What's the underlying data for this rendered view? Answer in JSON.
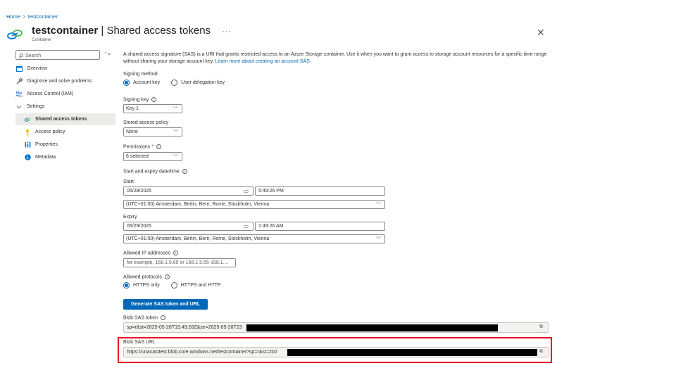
{
  "breadcrumb": {
    "home": "Home",
    "separator": ">",
    "current": "testcontainer"
  },
  "header": {
    "name": "testcontainer",
    "divider": "|",
    "section": "Shared access tokens",
    "more": "···",
    "subtitle": "Container",
    "close": "✕",
    "icon": "container-icon"
  },
  "sidebar": {
    "search_placeholder": "Search",
    "search_ctl": "⌃",
    "collapse": "«",
    "items": [
      {
        "label": "Overview",
        "icon": "overview-icon"
      },
      {
        "label": "Diagnose and solve problems",
        "icon": "wrench-icon"
      },
      {
        "label": "Access Control (IAM)",
        "icon": "people-icon"
      },
      {
        "label": "Settings",
        "icon": "chevron-down-icon"
      },
      {
        "label": "Shared access tokens",
        "icon": "link-icon",
        "active": true
      },
      {
        "label": "Access policy",
        "icon": "key-icon"
      },
      {
        "label": "Properties",
        "icon": "bars-icon"
      },
      {
        "label": "Metadata",
        "icon": "info-icon"
      }
    ]
  },
  "main": {
    "description": "A shared access signature (SAS) is a URI that grants restricted access to an Azure Storage container. Use it when you want to grant access to storage account resources for a specific time range without sharing your storage account key.",
    "learn_more": "Learn more about creating an account SAS",
    "signing_method": {
      "label": "Signing method",
      "option_1": "Account key",
      "option_2": "User delegation key"
    },
    "signing_key": {
      "label": "Signing key",
      "value": "Key 1"
    },
    "stored_policy": {
      "label": "Stored access policy",
      "value": "None"
    },
    "permissions": {
      "label": "Permissions",
      "required": "*",
      "value": "6 selected"
    },
    "start_expiry_label": "Start and expiry date/time",
    "start": {
      "label": "Start",
      "date": "05/28/2025",
      "time": "5:49:26 PM",
      "timezone": "(UTC+01:00) Amsterdam, Berlin, Bern, Rome, Stockholm, Vienna"
    },
    "expiry": {
      "label": "Expiry",
      "date": "05/29/2025",
      "time": "1:49:26 AM",
      "timezone": "(UTC+01:00) Amsterdam, Berlin, Bern, Rome, Stockholm, Vienna"
    },
    "allowed_ips": {
      "label": "Allowed IP addresses",
      "placeholder": "for example, 168.1.5.65 or 168.1.5.65-168.1...."
    },
    "protocols": {
      "label": "Allowed protocols",
      "option_1": "HTTPS only",
      "option_2": "HTTPS and HTTP"
    },
    "generate_button": "Generate SAS token and URL",
    "sas_token": {
      "label": "Blob SAS token",
      "value": "sp=r&st=2025-05-28T15:49:26Z&se=2025-05-28T23"
    },
    "sas_url": {
      "label": "Blob SAS URL",
      "value": "https://unacasttest.blob.core.windows.net/testcontainer?sp=r&st=202"
    }
  },
  "colors": {
    "accent": "#0067b8",
    "highlight": "#e81123",
    "redaction": "#000000"
  }
}
